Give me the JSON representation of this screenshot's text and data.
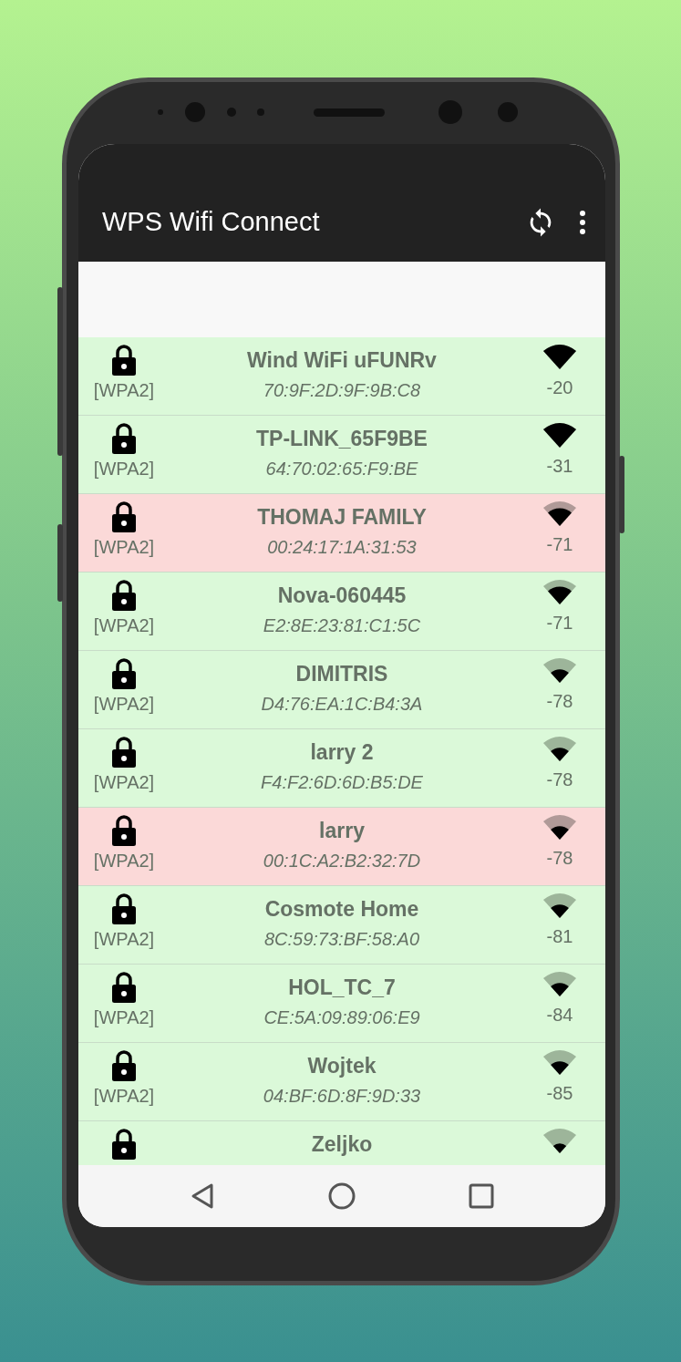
{
  "app_bar": {
    "title": "WPS Wifi Connect"
  },
  "networks": [
    {
      "name": "Wind WiFi uFUNRv",
      "bssid": "70:9F:2D:9F:9B:C8",
      "security": "[WPA2]",
      "rssi": "-20",
      "color": "#dbf9d9"
    },
    {
      "name": "TP-LINK_65F9BE",
      "bssid": "64:70:02:65:F9:BE",
      "security": "[WPA2]",
      "rssi": "-31",
      "color": "#dbf9d9"
    },
    {
      "name": "THOMAJ FAMILY",
      "bssid": "00:24:17:1A:31:53",
      "security": "[WPA2]",
      "rssi": "-71",
      "color": "#fbd9d8"
    },
    {
      "name": "Nova-060445",
      "bssid": "E2:8E:23:81:C1:5C",
      "security": "[WPA2]",
      "rssi": "-71",
      "color": "#dbf9d9"
    },
    {
      "name": "DIMITRIS",
      "bssid": "D4:76:EA:1C:B4:3A",
      "security": "[WPA2]",
      "rssi": "-78",
      "color": "#dbf9d9"
    },
    {
      "name": "larry 2",
      "bssid": "F4:F2:6D:6D:B5:DE",
      "security": "[WPA2]",
      "rssi": "-78",
      "color": "#dbf9d9"
    },
    {
      "name": "larry",
      "bssid": "00:1C:A2:B2:32:7D",
      "security": "[WPA2]",
      "rssi": "-78",
      "color": "#fbd9d8"
    },
    {
      "name": "Cosmote Home",
      "bssid": "8C:59:73:BF:58:A0",
      "security": "[WPA2]",
      "rssi": "-81",
      "color": "#dbf9d9"
    },
    {
      "name": "HOL_TC_7",
      "bssid": "CE:5A:09:89:06:E9",
      "security": "[WPA2]",
      "rssi": "-84",
      "color": "#dbf9d9"
    },
    {
      "name": "Wojtek",
      "bssid": "04:BF:6D:8F:9D:33",
      "security": "[WPA2]",
      "rssi": "-85",
      "color": "#dbf9d9"
    },
    {
      "name": "Zeljko",
      "color": "#dbf9d9"
    }
  ]
}
